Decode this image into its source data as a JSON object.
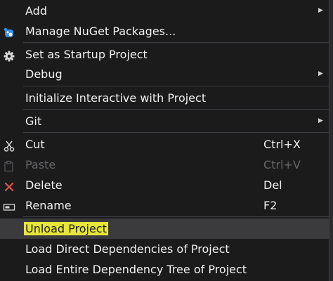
{
  "menu": {
    "items": [
      {
        "label": "Add",
        "icon": "none",
        "submenu": true,
        "shortcut": ""
      },
      {
        "label": "Manage NuGet Packages...",
        "icon": "nuget-icon",
        "submenu": false,
        "shortcut": ""
      },
      {
        "label": "Set as Startup Project",
        "icon": "gear-icon",
        "submenu": false,
        "shortcut": ""
      },
      {
        "label": "Debug",
        "icon": "none",
        "submenu": true,
        "shortcut": ""
      },
      {
        "label": "Initialize Interactive with Project",
        "icon": "none",
        "submenu": false,
        "shortcut": ""
      },
      {
        "label": "Git",
        "icon": "none",
        "submenu": true,
        "shortcut": ""
      },
      {
        "label": "Cut",
        "icon": "scissors-icon",
        "submenu": false,
        "shortcut": "Ctrl+X"
      },
      {
        "label": "Paste",
        "icon": "paste-icon",
        "submenu": false,
        "shortcut": "Ctrl+V",
        "disabled": true
      },
      {
        "label": "Delete",
        "icon": "delete-icon",
        "submenu": false,
        "shortcut": "Del"
      },
      {
        "label": "Rename",
        "icon": "rename-icon",
        "submenu": false,
        "shortcut": "F2"
      },
      {
        "label": "Unload Project",
        "icon": "none",
        "submenu": false,
        "shortcut": "",
        "highlighted": true
      },
      {
        "label": "Load Direct Dependencies of Project",
        "icon": "none",
        "submenu": false,
        "shortcut": ""
      },
      {
        "label": "Load Entire Dependency Tree of Project",
        "icon": "none",
        "submenu": false,
        "shortcut": ""
      }
    ],
    "submenu_arrow": "▶"
  },
  "colors": {
    "background": "#1b1b1c",
    "text": "#f1f1f1",
    "disabled_text": "#666669",
    "separator": "#3f3f46",
    "highlight_row": "#3b3b3d",
    "highlight_marker": "#e6e63a",
    "delete_icon": "#e05252",
    "nuget_icon": "#3a8ee6"
  }
}
